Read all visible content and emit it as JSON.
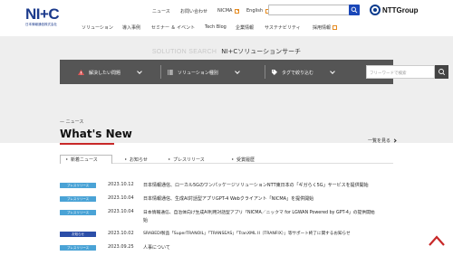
{
  "header": {
    "logo_mark": "NI+C",
    "logo_sub": "日本情報通信株式会社",
    "util_links": [
      {
        "label": "ニュース"
      },
      {
        "label": "お問い合わせ"
      },
      {
        "label": "NICMA"
      },
      {
        "label": "English"
      }
    ],
    "group_logo": "NTTGroup"
  },
  "nav": [
    {
      "label": "ソリューション"
    },
    {
      "label": "導入事例"
    },
    {
      "label": "セミナー ＆ イベント"
    },
    {
      "label": "Tech Blog"
    },
    {
      "label": "企業情報"
    },
    {
      "label": "サステナビリティ"
    },
    {
      "label": "採用情報"
    }
  ],
  "solution_search": {
    "title_en": "SOLUTION SEARCH",
    "title_ja": "NI+Cソリューションサーチ",
    "filters": [
      {
        "label": "解決したい問題",
        "icon": "warning-icon",
        "color": "#e05a5a"
      },
      {
        "label": "ソリューション種別",
        "icon": "list-icon",
        "color": "#ffffff"
      },
      {
        "label": "タグで絞り込む",
        "icon": "tag-icon",
        "color": "#ffffff"
      }
    ],
    "keyword_placeholder": "フリーワードで検索"
  },
  "news": {
    "label": "ニュース",
    "title": "What's New",
    "view_all": "一覧を見る",
    "tabs": [
      {
        "label": "新着ニュース",
        "active": true
      },
      {
        "label": "お知らせ",
        "active": false
      },
      {
        "label": "プレスリリース",
        "active": false
      },
      {
        "label": "受賞履歴",
        "active": false
      }
    ],
    "items": [
      {
        "badge": "プレスリリース",
        "badge_color": "#4aa3d6",
        "date": "2023.10.12",
        "text": "日本情報通信、ローカル5GのワンパッケージソリューションNTT東日本の「ギガらく5G」サービスを提供開始",
        "text2": ""
      },
      {
        "badge": "プレスリリース",
        "badge_color": "#4aa3d6",
        "date": "2023.10.04",
        "text": "日本情報通信、生成AI対話型アプリGPT-4 Webクライアント「NICMA」を提供開始",
        "text2": ""
      },
      {
        "badge": "プレスリリース",
        "badge_color": "#4aa3d6",
        "date": "2023.10.04",
        "text": "日本情報通信、自治体向け生成AI利用対話型アプリ「NICMA／ニックマ for LGWAN Powered by GPT-4」の提供開始",
        "text2": "始"
      },
      {
        "badge": "お知らせ",
        "badge_color": "#2b4ea8",
        "date": "2023.10.02",
        "text": "SRABEDI製品「SuperTRANOIL」「TRANSEAS」「TranXML II（TRANFIX）」等サポート終了に関するお知らせ",
        "text2": ""
      },
      {
        "badge": "プレスリリース",
        "badge_color": "#4aa3d6",
        "date": "2023.09.25",
        "text": "人事について",
        "text2": ""
      }
    ]
  }
}
